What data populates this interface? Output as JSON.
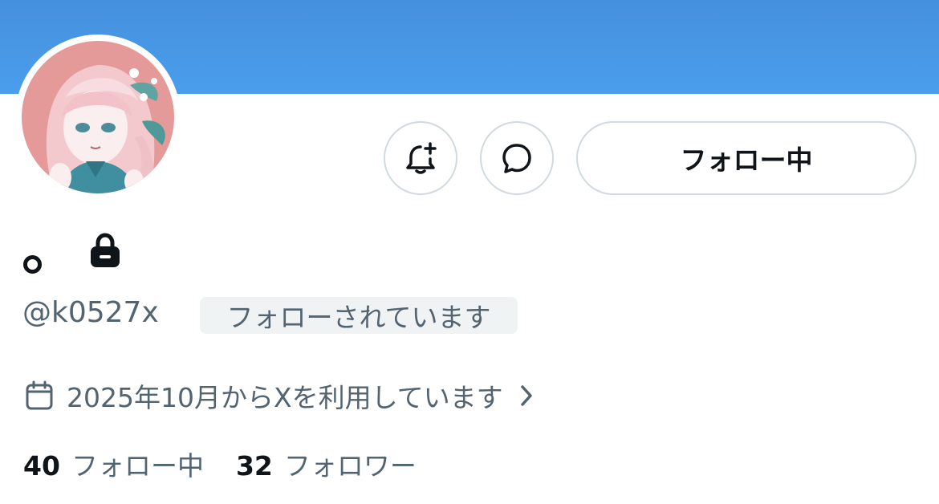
{
  "profile": {
    "banner_color": "#4a9eec",
    "display_name": "。",
    "handle": "@k0527x",
    "follows_you_label": "フォローされています",
    "joined_text": "2025年10月からXを利用しています",
    "protected": true
  },
  "actions": {
    "notify_icon": "bell-plus-icon",
    "message_icon": "message-bubble-icon",
    "follow_label": "フォロー中"
  },
  "stats": {
    "following_count": "40",
    "following_label": "フォロー中",
    "followers_count": "32",
    "followers_label": "フォロワー"
  }
}
